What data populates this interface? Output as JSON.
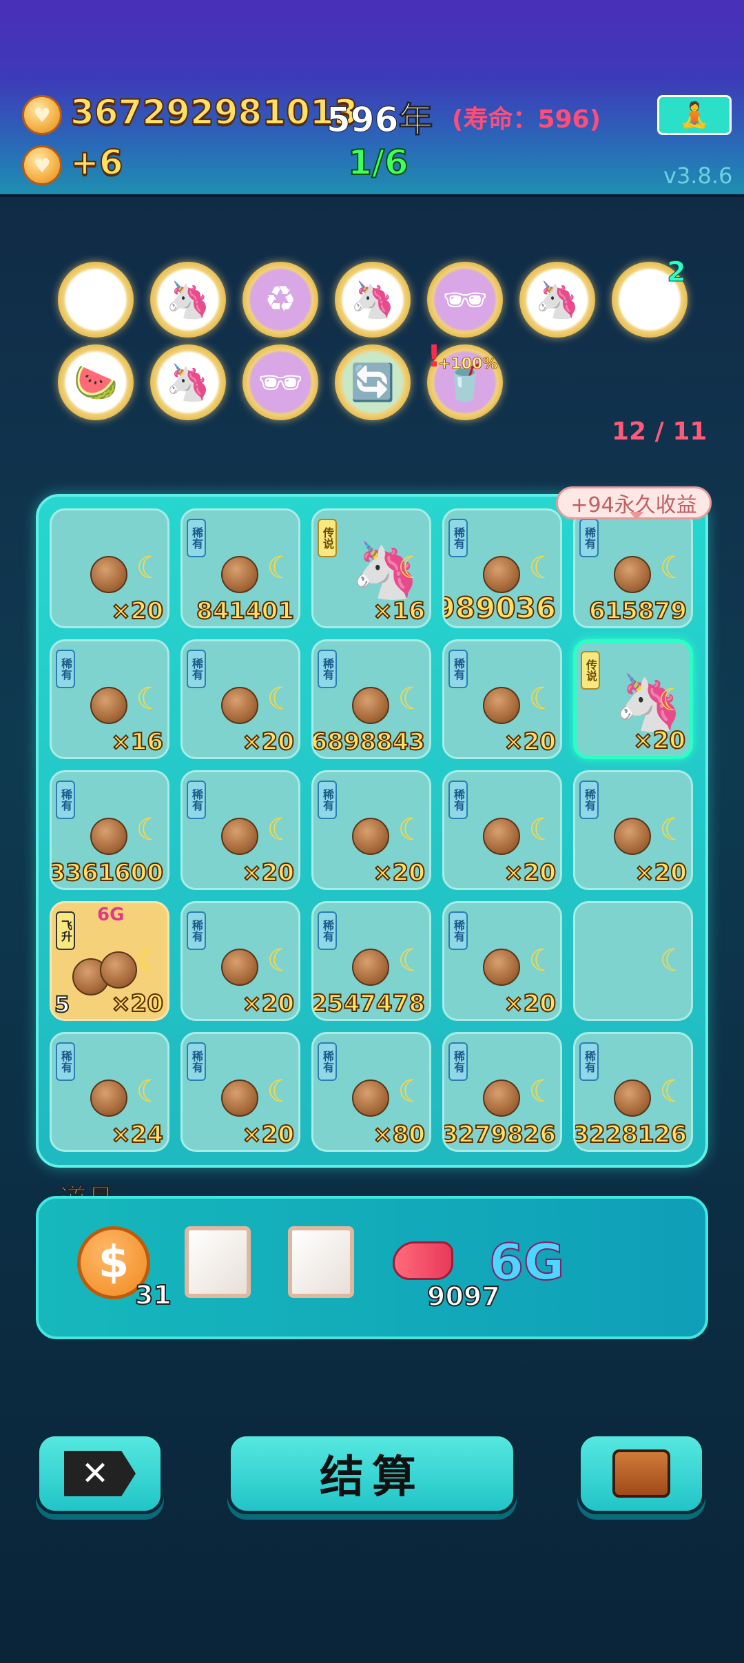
{
  "header": {
    "money": "367292981013",
    "years": "596年",
    "lifespan": "(寿命：596)",
    "income": "+6",
    "stage": "1/6",
    "version": "v3.8.6"
  },
  "skills": {
    "row1": [
      {
        "icon": "lightning-icon",
        "glyph": "⚡"
      },
      {
        "icon": "unicorn-icon",
        "glyph": "🦄"
      },
      {
        "icon": "recycle-icon",
        "glyph": "♻"
      },
      {
        "icon": "unicorn-icon",
        "glyph": "🦄"
      },
      {
        "icon": "walnut-sunglasses-icon",
        "glyph": "🕶"
      },
      {
        "icon": "unicorn-icon",
        "glyph": "🦄"
      },
      {
        "icon": "skip-icon",
        "glyph": "⏭"
      }
    ],
    "row2": [
      {
        "icon": "fruit-bowl-icon",
        "glyph": "🍉"
      },
      {
        "icon": "unicorn-icon",
        "glyph": "🦄"
      },
      {
        "icon": "walnut-sunglasses-icon",
        "glyph": "🕶"
      },
      {
        "icon": "refresh-icon",
        "glyph": "🔄"
      },
      {
        "icon": "drink-cup-icon",
        "glyph": "🥤"
      }
    ],
    "skip_badge": "2",
    "cup_label": "+100%",
    "alert": "!",
    "counter": "12 / 11"
  },
  "tooltip": "+94永久收益",
  "grid": [
    {
      "tag": "",
      "item": "walnut",
      "count": "×20"
    },
    {
      "tag": "稀有",
      "item": "walnut",
      "count": "841401"
    },
    {
      "tag": "传说",
      "item": "unicorn",
      "count": "×16"
    },
    {
      "tag": "稀有",
      "item": "walnut",
      "count": "6989036",
      "big": true
    },
    {
      "tag": "稀有",
      "item": "walnut",
      "count": "615879"
    },
    {
      "tag": "稀有",
      "item": "walnut",
      "count": "×16"
    },
    {
      "tag": "稀有",
      "item": "walnut",
      "count": "×20"
    },
    {
      "tag": "稀有",
      "item": "walnut",
      "count": "6898843"
    },
    {
      "tag": "稀有",
      "item": "walnut",
      "count": "×20"
    },
    {
      "tag": "传说",
      "item": "unicorn",
      "count": "×20",
      "selected": true
    },
    {
      "tag": "稀有",
      "item": "walnut",
      "count": "3361600"
    },
    {
      "tag": "稀有",
      "item": "walnut",
      "count": "×20"
    },
    {
      "tag": "稀有",
      "item": "walnut",
      "count": "×20"
    },
    {
      "tag": "稀有",
      "item": "walnut",
      "count": "×20"
    },
    {
      "tag": "稀有",
      "item": "walnut",
      "count": "×20"
    },
    {
      "tag": "飞升",
      "item": "walnut-pair",
      "count": "×20",
      "level": "5",
      "sixg": "6G",
      "gold": true
    },
    {
      "tag": "稀有",
      "item": "walnut",
      "count": "×20"
    },
    {
      "tag": "稀有",
      "item": "walnut",
      "count": "2547478"
    },
    {
      "tag": "稀有",
      "item": "walnut",
      "count": "×20"
    },
    {
      "tag": "",
      "item": "empty",
      "count": ""
    },
    {
      "tag": "稀有",
      "item": "walnut",
      "count": "×24"
    },
    {
      "tag": "稀有",
      "item": "walnut",
      "count": "×20"
    },
    {
      "tag": "稀有",
      "item": "walnut",
      "count": "×80"
    },
    {
      "tag": "稀有",
      "item": "walnut",
      "count": "3279826"
    },
    {
      "tag": "稀有",
      "item": "walnut",
      "count": "3228126"
    }
  ],
  "props": {
    "label": "道具",
    "coin_count": "31",
    "liver_count": "9097",
    "sixg": "6G"
  },
  "buttons": {
    "settle": "结算"
  },
  "colors": {
    "accent": "#27d6cf",
    "money": "#ffe066",
    "stage": "#3fff5c",
    "life": "#ff4d7a"
  }
}
